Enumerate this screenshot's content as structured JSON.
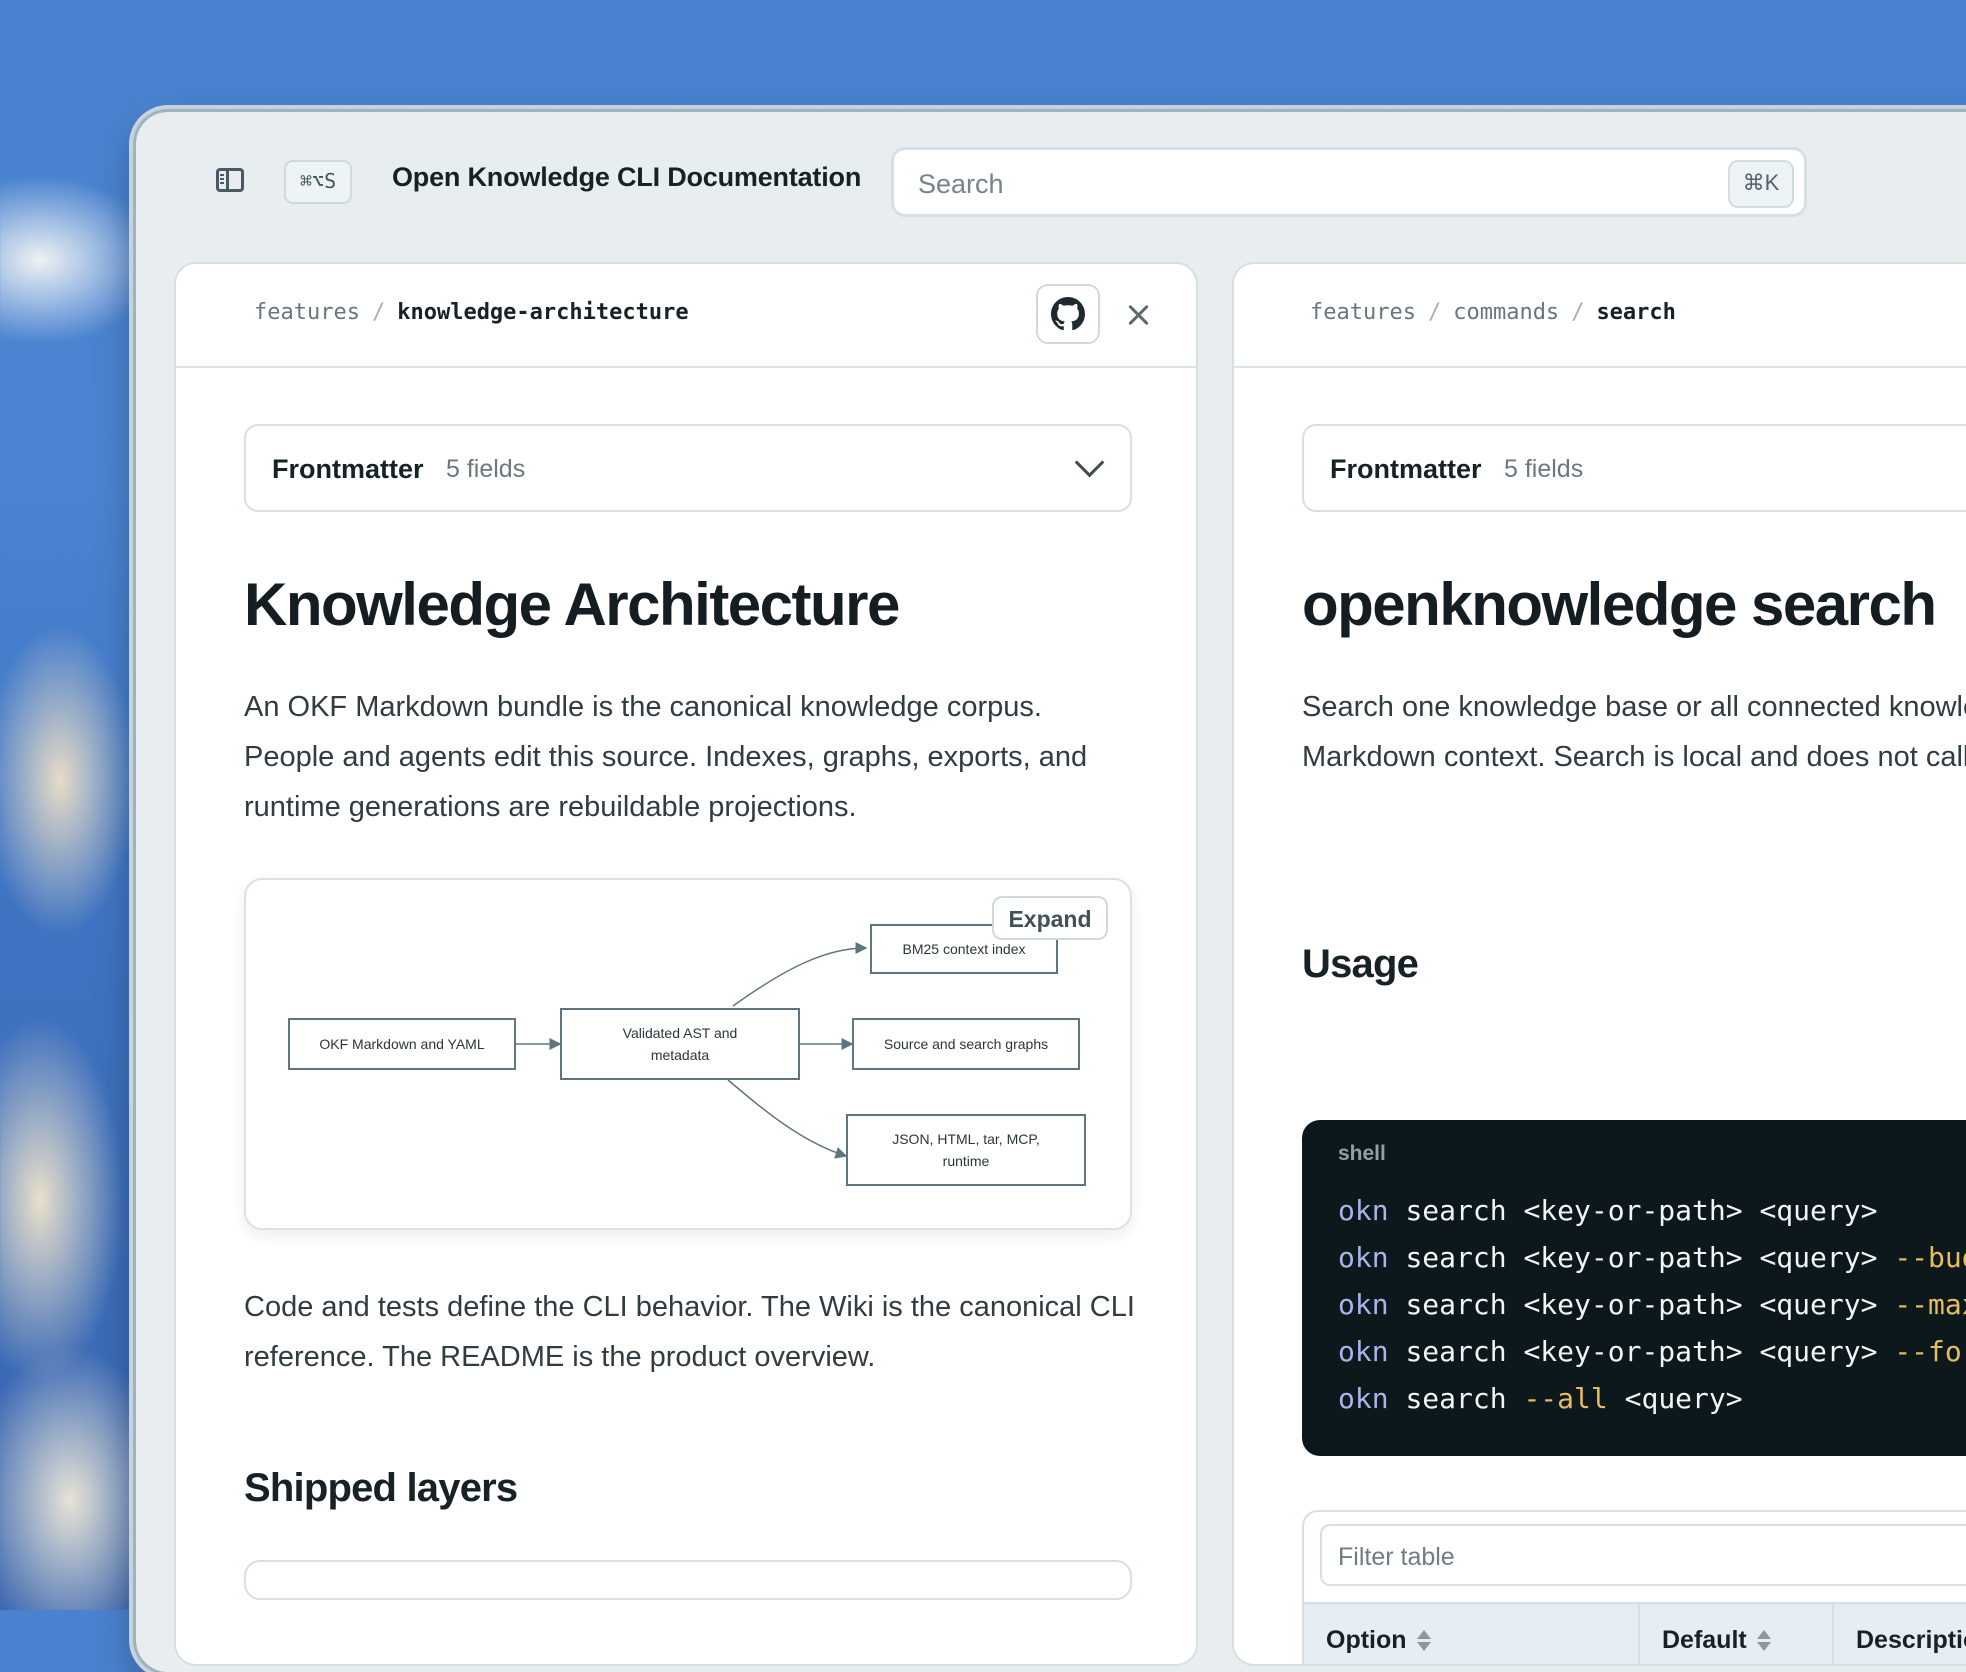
{
  "topbar": {
    "shortcut": "⌘⌥S",
    "title": "Open Knowledge CLI Documentation",
    "search_placeholder": "Search",
    "search_shortcut": "⌘K"
  },
  "left_pane": {
    "breadcrumb": [
      "features",
      "knowledge-architecture"
    ],
    "frontmatter_label": "Frontmatter",
    "frontmatter_count": "5 fields",
    "title": "Knowledge Architecture",
    "intro": "An OKF Markdown bundle is the canonical knowledge corpus. People and agents edit this source. Indexes, graphs, exports, and runtime generations are rebuildable projections.",
    "diagram": {
      "expand_label": "Expand",
      "nodes": {
        "source": "OKF Markdown and YAML",
        "ast": "Validated AST and metadata",
        "bm25": "BM25 context index",
        "graphs": "Source and search graphs",
        "exports": "JSON, HTML, tar, MCP, runtime"
      }
    },
    "outro": "Code and tests define the CLI behavior. The Wiki is the canonical CLI reference. The README is the product overview.",
    "section_heading": "Shipped layers"
  },
  "right_pane": {
    "breadcrumb": [
      "features",
      "commands",
      "search"
    ],
    "frontmatter_label": "Frontmatter",
    "frontmatter_count": "5 fields",
    "title": "openknowledge search",
    "intro": "Search one knowledge base or all connected knowledge bases for source-based Markdown context. Search is local and does not call an LLM.",
    "usage_heading": "Usage",
    "code": {
      "lang": "shell",
      "lines": [
        [
          "okn",
          "search <key-or-path> <query>",
          ""
        ],
        [
          "okn",
          "search <key-or-path> <query> ",
          "--budget"
        ],
        [
          "okn",
          "search <key-or-path> <query> ",
          "--max"
        ],
        [
          "okn",
          "search <key-or-path> <query> ",
          "--format"
        ],
        [
          "okn",
          "search ",
          "--all",
          " <query>"
        ]
      ]
    },
    "table": {
      "filter_placeholder": "Filter table",
      "columns": [
        "Option",
        "Default",
        "Description"
      ]
    }
  }
}
